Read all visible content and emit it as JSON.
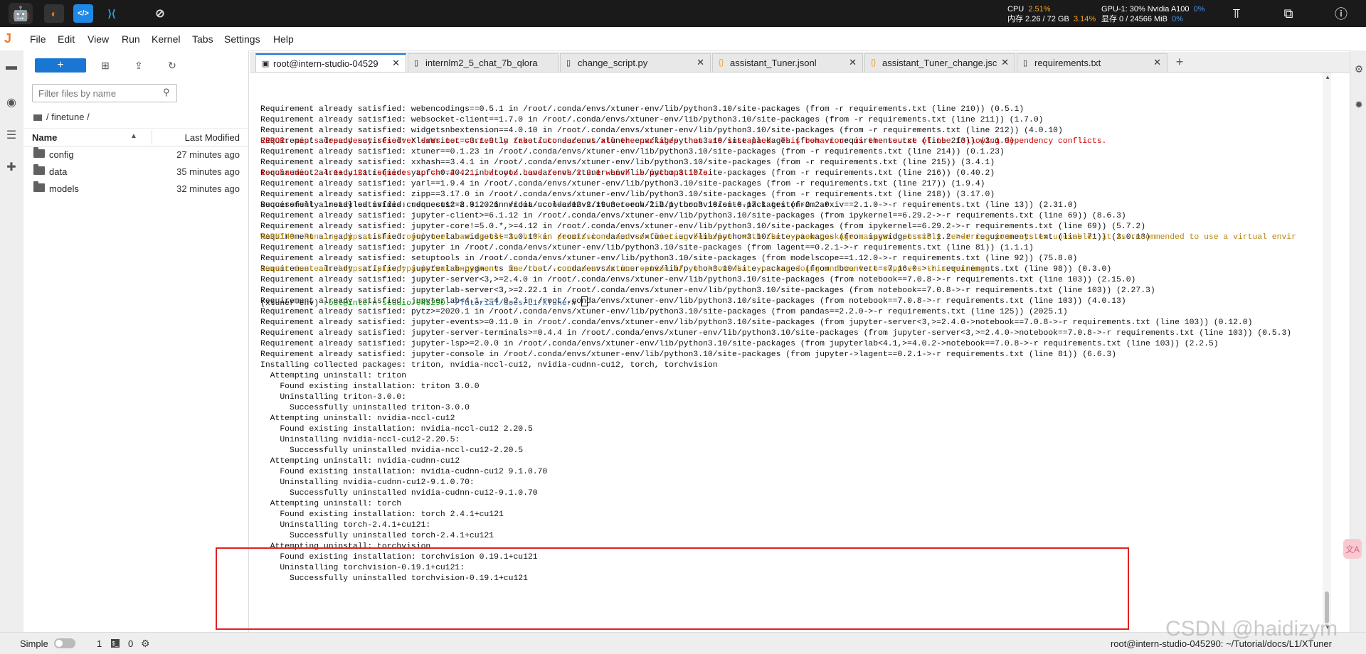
{
  "system_bar": {
    "cpu_label": "CPU",
    "cpu_pct": "2.51%",
    "mem_label": "内存 2.26 / 72 GB",
    "mem_pct": "3.14%",
    "gpu_label": "GPU-1: 30% Nvidia A100",
    "gpu_pct": "0%",
    "vram_label": "显存 0 / 24566 MiB",
    "vram_pct": "0%"
  },
  "menu": [
    "File",
    "Edit",
    "View",
    "Run",
    "Kernel",
    "Tabs",
    "Settings",
    "Help"
  ],
  "file_browser": {
    "new_button": "+",
    "search_placeholder": "Filter files by name",
    "breadcrumb": "/ finetune /",
    "col_name": "Name",
    "col_modified": "Last Modified",
    "items": [
      {
        "name": "config",
        "modified": "27 minutes ago"
      },
      {
        "name": "data",
        "modified": "35 minutes ago"
      },
      {
        "name": "models",
        "modified": "32 minutes ago"
      }
    ]
  },
  "tabs": [
    {
      "label": "root@intern-studio-04529",
      "icon": "terminal-icon"
    },
    {
      "label": "internlm2_5_chat_7b_qlora",
      "icon": "file-icon"
    },
    {
      "label": "change_script.py",
      "icon": "file-icon"
    },
    {
      "label": "assistant_Tuner.jsonl",
      "icon": "json-icon"
    },
    {
      "label": "assistant_Tuner_change.jsc",
      "icon": "json-icon"
    },
    {
      "label": "requirements.txt",
      "icon": "file-icon"
    }
  ],
  "terminal": {
    "lines": [
      "Requirement already satisfied: webencodings==0.5.1 in /root/.conda/envs/xtuner-env/lib/python3.10/site-packages (from -r requirements.txt (line 210)) (0.5.1)",
      "Requirement already satisfied: websocket-client==1.7.0 in /root/.conda/envs/xtuner-env/lib/python3.10/site-packages (from -r requirements.txt (line 211)) (1.7.0)",
      "Requirement already satisfied: widgetsnbextension==4.0.10 in /root/.conda/envs/xtuner-env/lib/python3.10/site-packages (from -r requirements.txt (line 212)) (4.0.10)",
      "Requirement already satisfied: XlsxWriter==3.1.9 in /root/.conda/envs/xtuner-env/lib/python3.10/site-packages (from -r requirements.txt (line 213)) (3.1.9)",
      "Requirement already satisfied: xtuner==0.1.23 in /root/.conda/envs/xtuner-env/lib/python3.10/site-packages (from -r requirements.txt (line 214)) (0.1.23)",
      "Requirement already satisfied: xxhash==3.4.1 in /root/.conda/envs/xtuner-env/lib/python3.10/site-packages (from -r requirements.txt (line 215)) (3.4.1)",
      "Requirement already satisfied: yapf==0.40.2 in /root/.conda/envs/xtuner-env/lib/python3.10/site-packages (from -r requirements.txt (line 216)) (0.40.2)",
      "Requirement already satisfied: yarl==1.9.4 in /root/.conda/envs/xtuner-env/lib/python3.10/site-packages (from -r requirements.txt (line 217)) (1.9.4)",
      "Requirement already satisfied: zipp==3.17.0 in /root/.conda/envs/xtuner-env/lib/python3.10/site-packages (from -r requirements.txt (line 218)) (3.17.0)",
      "Requirement already satisfied: requests==2.31.0 in /root/.conda/envs/xtuner-env/lib/python3.10/site-packages (from arxiv==2.1.0->-r requirements.txt (line 13)) (2.31.0)",
      "Requirement already satisfied: jupyter-client>=6.1.12 in /root/.conda/envs/xtuner-env/lib/python3.10/site-packages (from ipykernel==6.29.2->-r requirements.txt (line 69)) (8.6.3)",
      "Requirement already satisfied: jupyter-core!=5.0.*,>=4.12 in /root/.conda/envs/xtuner-env/lib/python3.10/site-packages (from ipykernel==6.29.2->-r requirements.txt (line 69)) (5.7.2)",
      "Requirement already satisfied: jupyterlab-widgets~=3.0.10 in /root/.conda/envs/xtuner-env/lib/python3.10/site-packages (from ipywidgets==8.1.2->-r requirements.txt (line 71)) (3.0.13)",
      "Requirement already satisfied: jupyter in /root/.conda/envs/xtuner-env/lib/python3.10/site-packages (from lagent==0.2.1->-r requirements.txt (line 81)) (1.1.1)",
      "Requirement already satisfied: setuptools in /root/.conda/envs/xtuner-env/lib/python3.10/site-packages (from modelscope==1.12.0->-r requirements.txt (line 92)) (75.8.0)",
      "Requirement already satisfied: jupyterlab-pygments in /root/.conda/envs/xtuner-env/lib/python3.10/site-packages (from nbconvert==7.16.0->-r requirements.txt (line 98)) (0.3.0)",
      "Requirement already satisfied: jupyter-server<3,>=2.4.0 in /root/.conda/envs/xtuner-env/lib/python3.10/site-packages (from notebook==7.0.8->-r requirements.txt (line 103)) (2.15.0)",
      "Requirement already satisfied: jupyterlab-server<3,>=2.22.1 in /root/.conda/envs/xtuner-env/lib/python3.10/site-packages (from notebook==7.0.8->-r requirements.txt (line 103)) (2.27.3)",
      "Requirement already satisfied: jupyterlab<4.1,>=4.0.2 in /root/.conda/envs/xtuner-env/lib/python3.10/site-packages (from notebook==7.0.8->-r requirements.txt (line 103)) (4.0.13)",
      "Requirement already satisfied: pytz>=2020.1 in /root/.conda/envs/xtuner-env/lib/python3.10/site-packages (from pandas==2.2.0->-r requirements.txt (line 125)) (2025.1)",
      "Requirement already satisfied: jupyter-events>=0.11.0 in /root/.conda/envs/xtuner-env/lib/python3.10/site-packages (from jupyter-server<3,>=2.4.0->notebook==7.0.8->-r requirements.txt (line 103)) (0.12.0)",
      "Requirement already satisfied: jupyter-server-terminals>=0.4.4 in /root/.conda/envs/xtuner-env/lib/python3.10/site-packages (from jupyter-server<3,>=2.4.0->notebook==7.0.8->-r requirements.txt (line 103)) (0.5.3)",
      "Requirement already satisfied: jupyter-lsp>=2.0.0 in /root/.conda/envs/xtuner-env/lib/python3.10/site-packages (from jupyterlab<4.1,>=4.0.2->notebook==7.0.8->-r requirements.txt (line 103)) (2.2.5)",
      "Requirement already satisfied: jupyter-console in /root/.conda/envs/xtuner-env/lib/python3.10/site-packages (from jupyter->lagent==0.2.1->-r requirements.txt (line 81)) (6.6.3)",
      "Installing collected packages: triton, nvidia-nccl-cu12, nvidia-cudnn-cu12, torch, torchvision",
      "  Attempting uninstall: triton",
      "    Found existing installation: triton 3.0.0",
      "    Uninstalling triton-3.0.0:",
      "      Successfully uninstalled triton-3.0.0",
      "  Attempting uninstall: nvidia-nccl-cu12",
      "    Found existing installation: nvidia-nccl-cu12 2.20.5",
      "    Uninstalling nvidia-nccl-cu12-2.20.5:",
      "      Successfully uninstalled nvidia-nccl-cu12-2.20.5",
      "  Attempting uninstall: nvidia-cudnn-cu12",
      "    Found existing installation: nvidia-cudnn-cu12 9.1.0.70",
      "    Uninstalling nvidia-cudnn-cu12-9.1.0.70:",
      "      Successfully uninstalled nvidia-cudnn-cu12-9.1.0.70",
      "  Attempting uninstall: torch",
      "    Found existing installation: torch 2.4.1+cu121",
      "    Uninstalling torch-2.4.1+cu121:",
      "      Successfully uninstalled torch-2.4.1+cu121",
      "  Attempting uninstall: torchvision",
      "    Found existing installation: torchvision 0.19.1+cu121",
      "    Uninstalling torchvision-0.19.1+cu121:",
      "      Successfully uninstalled torchvision-0.19.1+cu121"
    ],
    "error_line_1": "ERROR: pip's dependency resolver does not currently take into account all the packages that are installed. This behaviour is the source of the following dependency conflicts.",
    "error_line_2": "torchaudio 2.4.1+cu121 requires torch==2.4.1, but you have torch 2.2.1 which is incompatible.",
    "success_line": "Successfully installed nvidia-cudnn-cu12-8.9.2.26 nvidia-nccl-cu12-2.19.3 torch-2.2.1 torchvision-0.17.1 triton-2.2.0",
    "warning_line_1": "WARNING: Running pip as the 'root' user can result in broken permissions and conflicting behaviour with the system package manager, possibly rendering your system unusable. It is recommended to use a virtual envir",
    "warning_line_2": "onment instead: https://pip.pypa.io/warnings/venv. Use the --root-user-action option if you know what you are doing and want to suppress this warning.",
    "prompt_env": "(xtuner-env) ",
    "prompt_user": "root@intern-studio-045290",
    "prompt_path": ":~/Tutorial/docs/L1/XTuner",
    "prompt_symbol": "# "
  },
  "status_bar": {
    "mode": "Simple",
    "count1": "1",
    "count2": "0",
    "right_text": "root@intern-studio-045290: ~/Tutorial/docs/L1/XTuner"
  },
  "watermark": "CSDN @haidizym",
  "colors": {
    "accent": "#1976d2",
    "error": "#cd0000",
    "warning": "#b8860b",
    "highlight_box": "#e02020"
  }
}
